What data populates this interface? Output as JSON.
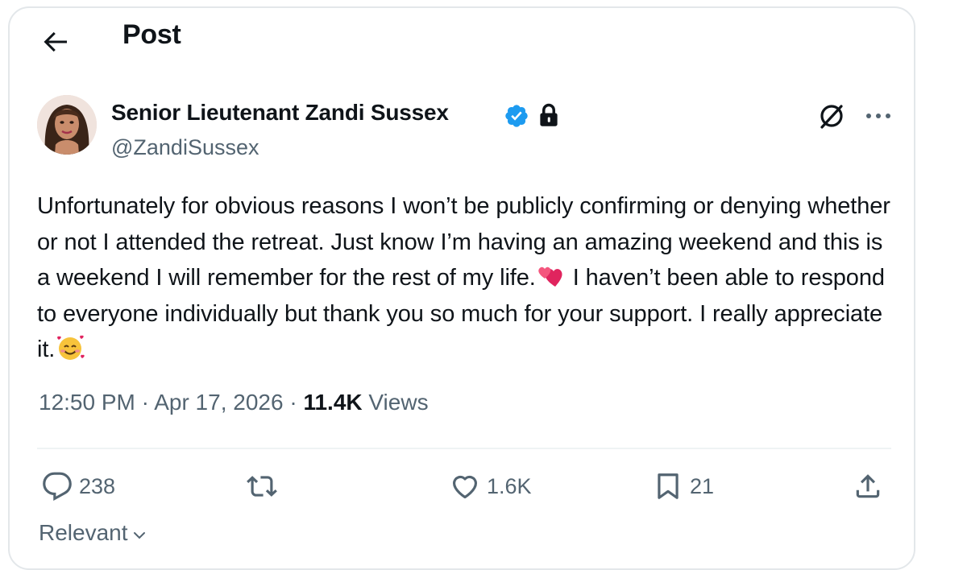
{
  "header": {
    "title": "Post",
    "back_icon": "arrow-left-icon"
  },
  "author": {
    "name": "Senior Lieutenant Zandi Sussex",
    "handle": "@ZandiSussex",
    "verified": true,
    "protected": true,
    "verified_color": "#1d9bf0"
  },
  "tweet": {
    "text_1": "Unfortunately for obvious reasons I won’t be publicly confirming or denying whether or not I attended the retreat. Just know I’m having an amazing weekend and this is a weekend I will remember for the rest of my life.",
    "emoji_1": "two-hearts-emoji",
    "text_2": " I haven’t been able to respond to everyone individually but thank you so much for your support. I really appreciate it.",
    "emoji_2": "smiling-face-with-hearts-emoji"
  },
  "meta": {
    "time": "12:50 PM",
    "sep1": " · ",
    "date": "Apr 17, 2026",
    "sep2": " · ",
    "views_count": "11.4K",
    "views_label": " Views"
  },
  "actions": {
    "replies": "238",
    "reposts": "",
    "likes": "1.6K",
    "bookmarks": "21"
  },
  "sort": {
    "label": "Relevant"
  },
  "colors": {
    "text": "#0f1419",
    "secondary": "#536471",
    "accent": "#1d9bf0"
  }
}
